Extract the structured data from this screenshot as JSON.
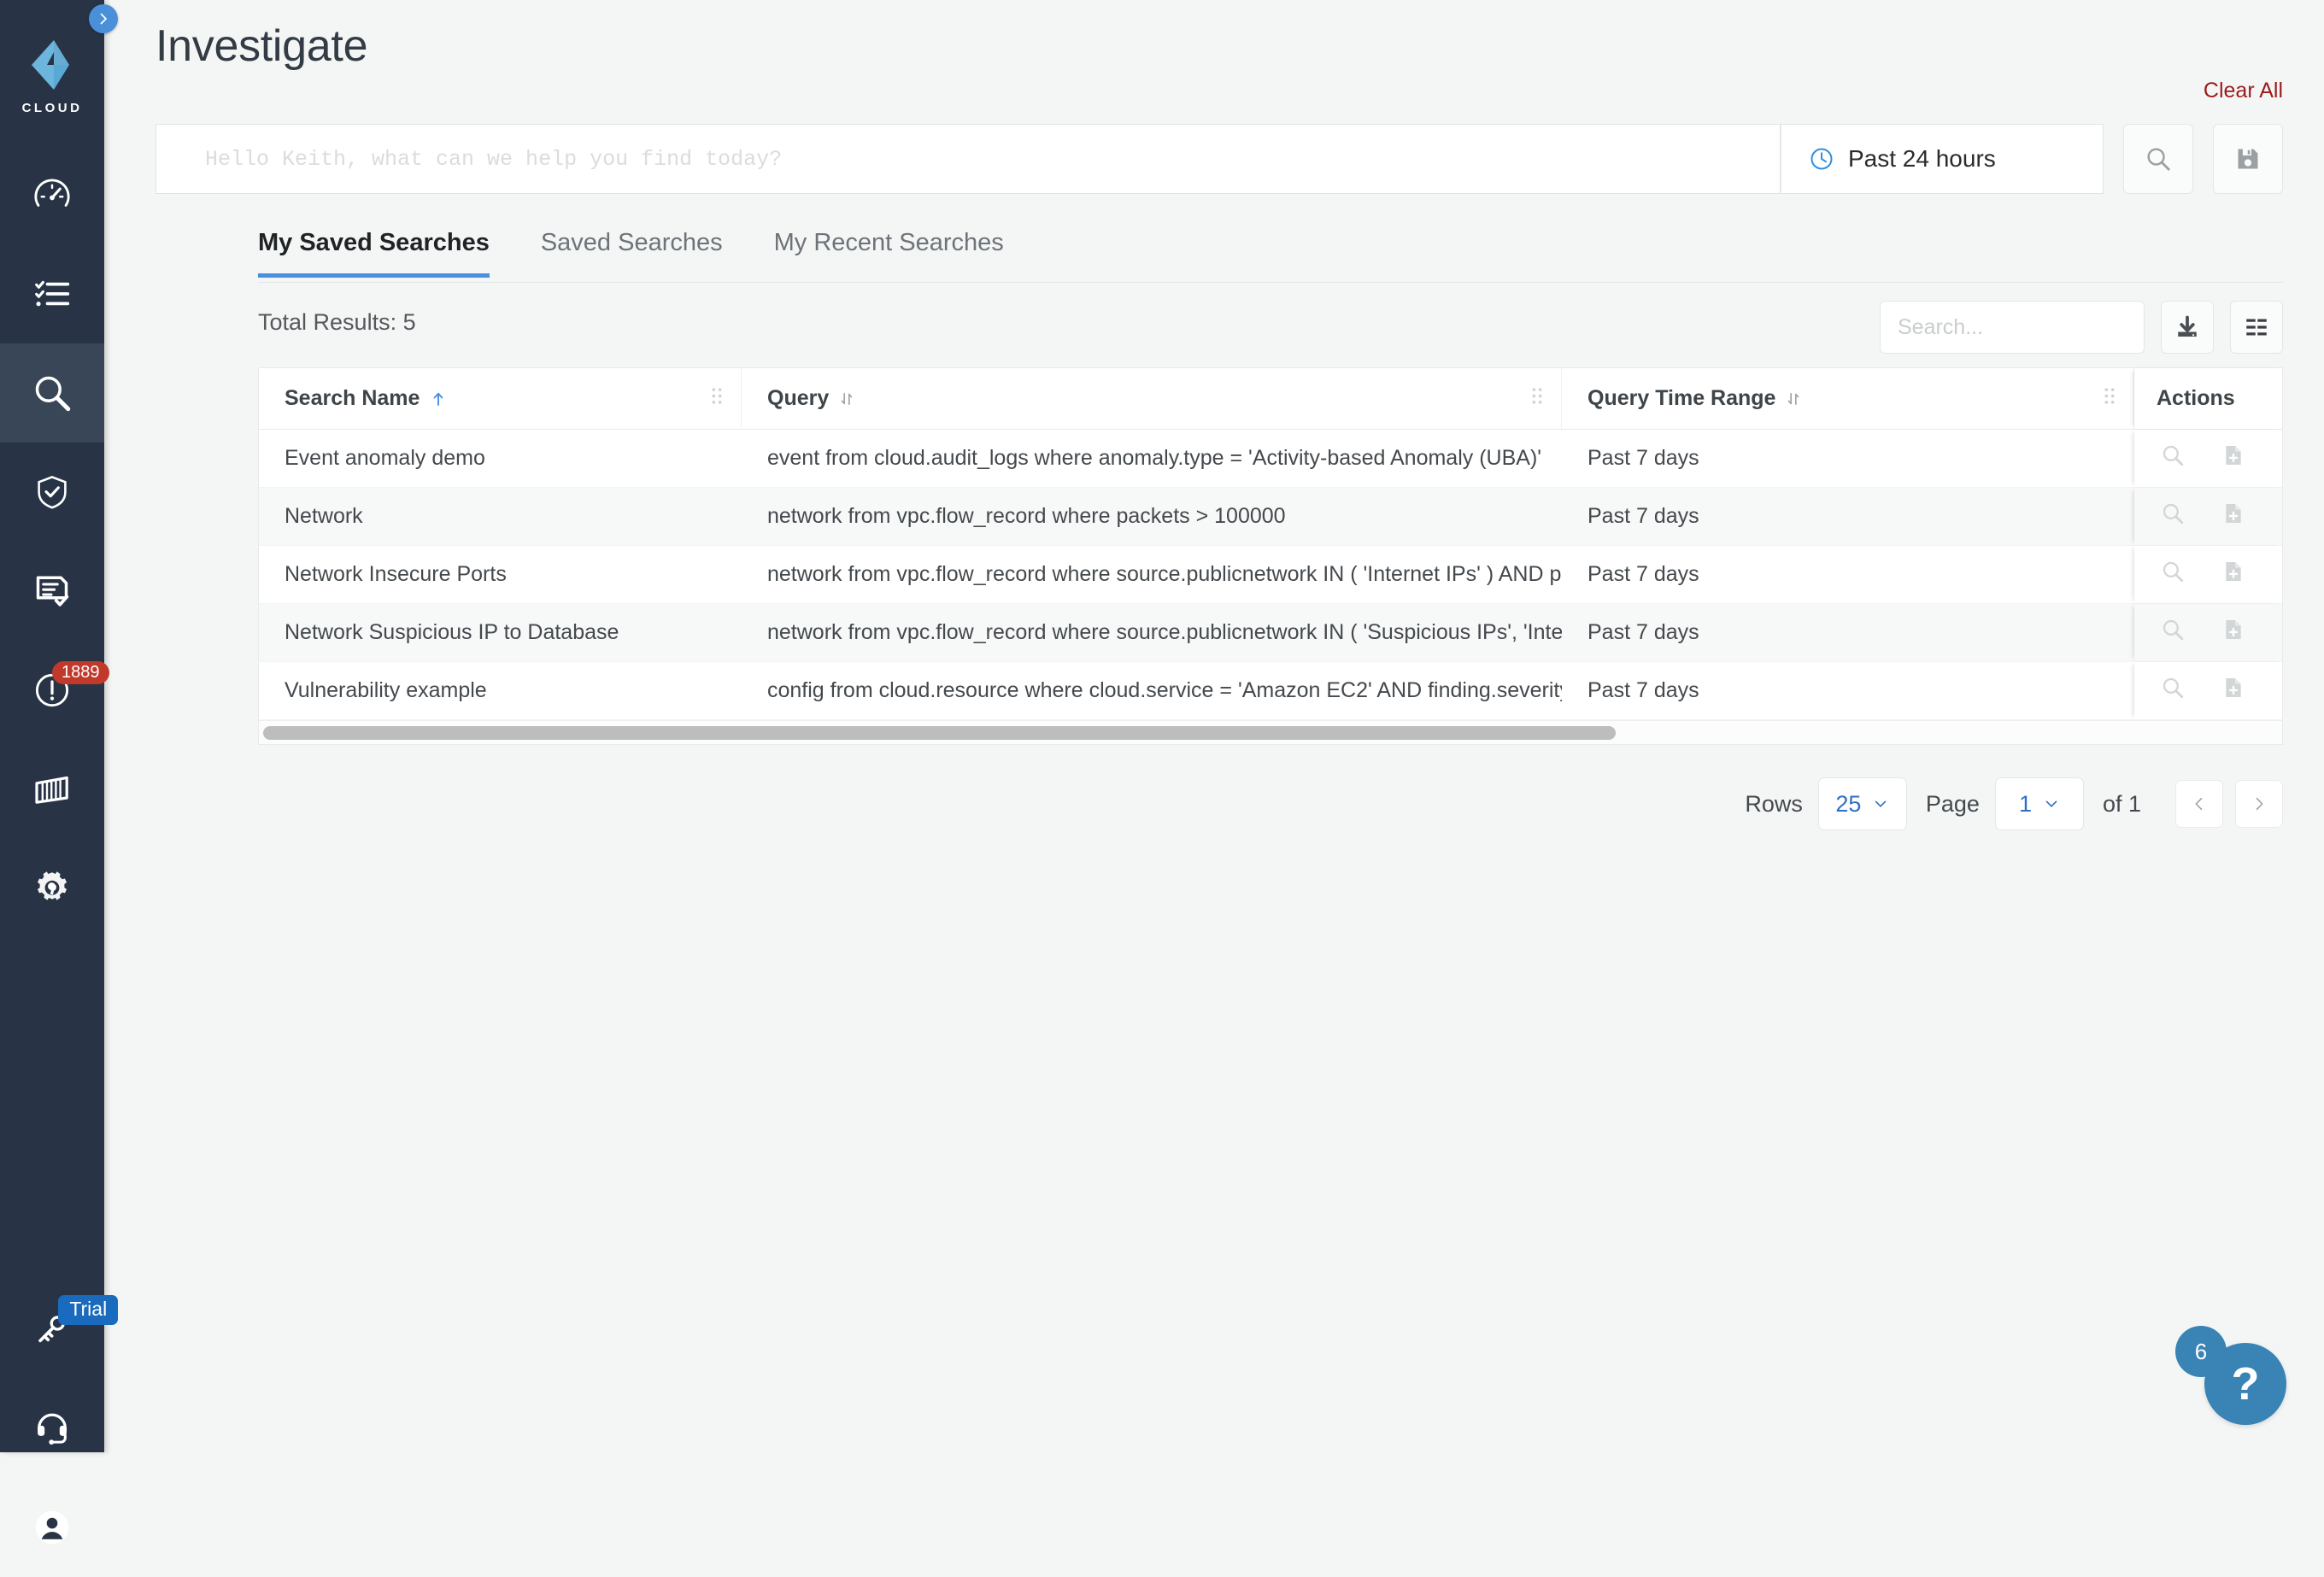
{
  "brand": {
    "name": "CLOUD",
    "logo_icon": "qualys-cloud-logo",
    "accent": "#6cb5dd",
    "sidebar_bg": "#283445"
  },
  "sidebar": {
    "toggle_icon": "chevron-right-icon",
    "items": [
      {
        "name": "dashboard",
        "icon": "speedometer-icon",
        "active": false
      },
      {
        "name": "checklist",
        "icon": "checklist-icon",
        "active": false
      },
      {
        "name": "investigate",
        "icon": "search-icon",
        "active": true
      },
      {
        "name": "posture",
        "icon": "shield-check-icon",
        "active": false
      },
      {
        "name": "reports",
        "icon": "report-check-icon",
        "active": false
      },
      {
        "name": "alerts",
        "icon": "exclamation-circle-icon",
        "active": false,
        "badge": "1889"
      },
      {
        "name": "containers",
        "icon": "container-icon",
        "active": false
      },
      {
        "name": "remediation",
        "icon": "gear-wrench-icon",
        "active": false
      }
    ],
    "bottom_items": [
      {
        "name": "licenses",
        "icon": "keys-icon",
        "active": false,
        "tag": "Trial"
      },
      {
        "name": "support",
        "icon": "headset-icon",
        "active": false
      },
      {
        "name": "account",
        "icon": "user-circle-icon",
        "active": false
      }
    ]
  },
  "header": {
    "title": "Investigate",
    "clear_all_label": "Clear All",
    "clear_all_color": "#9c1a1a"
  },
  "search": {
    "placeholder": "Hello Keith, what can we help you find today?",
    "value": "",
    "time_range": {
      "icon": "clock-icon",
      "label": "Past 24 hours"
    },
    "run_button_icon": "search-icon",
    "save_button_icon": "save-disk-icon"
  },
  "tabs": [
    {
      "label": "My Saved Searches",
      "active": true
    },
    {
      "label": "Saved Searches",
      "active": false
    },
    {
      "label": "My Recent Searches",
      "active": false
    }
  ],
  "results": {
    "total_label": "Total Results: 5",
    "toolbar": {
      "search_placeholder": "Search...",
      "search_value": "",
      "search_icon": "search-icon",
      "download_icon": "download-icon",
      "columns_icon": "column-settings-icon"
    },
    "columns": [
      {
        "label": "Search Name",
        "sort": "asc",
        "grip": true
      },
      {
        "label": "Query",
        "sort": "none",
        "grip": true
      },
      {
        "label": "Query Time Range",
        "sort": "none",
        "grip": true
      },
      {
        "label": "Actions",
        "sort": null,
        "grip": false
      }
    ],
    "rows": [
      {
        "name": "Event anomaly demo",
        "query": "event from cloud.audit_logs where anomaly.type = 'Activity-based Anomaly (UBA)'",
        "time_range": "Past 7 days"
      },
      {
        "name": "Network",
        "query": "network from vpc.flow_record where packets > 100000",
        "time_range": "Past 7 days"
      },
      {
        "name": "Network Insecure Ports",
        "query": "network from vpc.flow_record where source.publicnetwork IN ( 'Internet IPs' ) AND pro…",
        "time_range": "Past 7 days"
      },
      {
        "name": "Network Suspicious IP to Database",
        "query": "network from vpc.flow_record where source.publicnetwork IN ( 'Suspicious IPs', 'Interne…",
        "time_range": "Past 7 days"
      },
      {
        "name": "Vulnerability example",
        "query": "config from cloud.resource where cloud.service = 'Amazon EC2' AND finding.severity = '…",
        "time_range": "Past 7 days"
      }
    ],
    "row_actions": [
      {
        "name": "view-search",
        "icon": "search-icon"
      },
      {
        "name": "create-report",
        "icon": "file-plus-icon"
      },
      {
        "name": "delete-search",
        "icon": "trash-icon"
      }
    ],
    "link_color": "#2f6fc4"
  },
  "pagination": {
    "rows_label": "Rows",
    "rows_value": "25",
    "page_label": "Page",
    "page_value": "1",
    "of_label": "of 1",
    "prev_icon": "chevron-left-icon",
    "next_icon": "chevron-right-icon"
  },
  "help": {
    "icon": "question-mark-icon",
    "label": "?",
    "count": "6",
    "color": "#3983b5"
  }
}
